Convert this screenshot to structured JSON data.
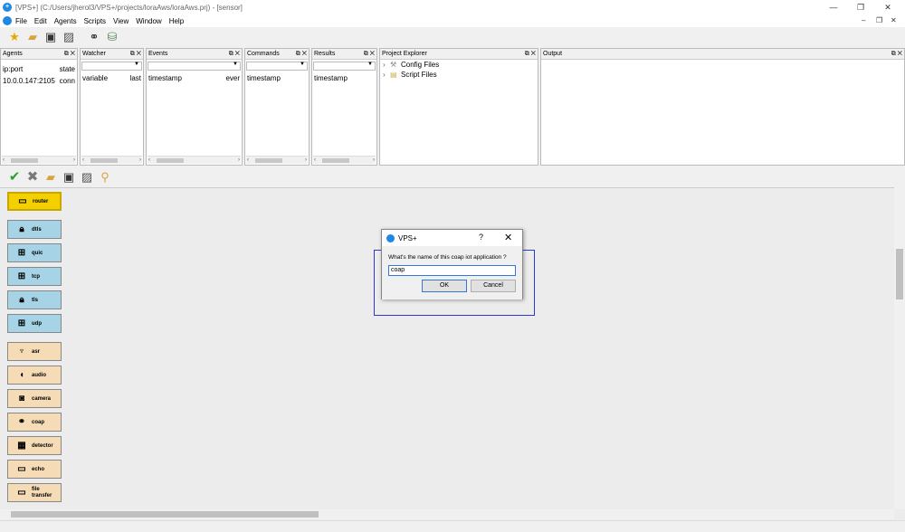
{
  "window": {
    "title": "[VPS+] (C:/Users/jherol3/VPS+/projects/loraAws/loraAws.prj) - [sensor]",
    "minimize": "—",
    "restore": "❐",
    "close": "✕"
  },
  "menubar": {
    "items": [
      "File",
      "Edit",
      "Agents",
      "Scripts",
      "View",
      "Window",
      "Help"
    ],
    "mdi_minimize": "–",
    "mdi_restore": "❐",
    "mdi_close": "✕"
  },
  "toolbar_top": {
    "icons": [
      "star-new-icon",
      "folder-open-icon",
      "save-icon",
      "save-as-icon",
      "binoculars-icon",
      "database-add-icon"
    ]
  },
  "panels": {
    "agents": {
      "title": "Agents",
      "headers": [
        "ip:port",
        "state"
      ],
      "rows": [
        [
          "10.0.0.147:2105",
          "conn"
        ]
      ]
    },
    "watcher": {
      "title": "Watcher",
      "headers": [
        "variable",
        "last"
      ]
    },
    "events": {
      "title": "Events",
      "headers": [
        "timestamp",
        "ever"
      ]
    },
    "commands": {
      "title": "Commands",
      "headers": [
        "timestamp"
      ]
    },
    "results": {
      "title": "Results",
      "headers": [
        "timestamp"
      ]
    },
    "project_explorer": {
      "title": "Project Explorer",
      "items": [
        "Config Files",
        "Script Files"
      ]
    },
    "output": {
      "title": "Output"
    },
    "dock_controls": "⧉ ✕"
  },
  "toolbar_canvas": {
    "icons": [
      "check-icon",
      "cancel-icon",
      "folder-open-icon",
      "save-icon",
      "save-as-icon",
      "broom-icon"
    ]
  },
  "palette": [
    {
      "label": "router",
      "icon": "router-icon",
      "style": "yellow"
    },
    {
      "label": "dtls",
      "icon": "lock-icon",
      "style": "blue"
    },
    {
      "label": "quic",
      "icon": "network-icon",
      "style": "blue"
    },
    {
      "label": "tcp",
      "icon": "network-icon",
      "style": "blue"
    },
    {
      "label": "tls",
      "icon": "lock-icon",
      "style": "blue"
    },
    {
      "label": "udp",
      "icon": "network-icon",
      "style": "blue"
    },
    {
      "label": "asr",
      "icon": "speech-icon",
      "style": "tan"
    },
    {
      "label": "audio",
      "icon": "speaker-icon",
      "style": "tan"
    },
    {
      "label": "camera",
      "icon": "camera-icon",
      "style": "tan"
    },
    {
      "label": "coap",
      "icon": "coap-icon",
      "style": "tan"
    },
    {
      "label": "detector",
      "icon": "grid-icon",
      "style": "tan"
    },
    {
      "label": "echo",
      "icon": "monitor-icon",
      "style": "tan"
    },
    {
      "label": "file transfer",
      "icon": "monitor-icon",
      "style": "tan"
    }
  ],
  "dialog": {
    "title": "VPS+",
    "help": "?",
    "close": "✕",
    "prompt": "What's the name of this coap iot application ?",
    "input_value": "coap",
    "ok_label": "OK",
    "cancel_label": "Cancel"
  },
  "colors": {
    "accent": "#1e88e5",
    "palette_yellow": "#f5d000",
    "palette_blue": "#a6d4e6",
    "palette_tan": "#f5dcb6",
    "highlight": "#2b3bd1"
  }
}
